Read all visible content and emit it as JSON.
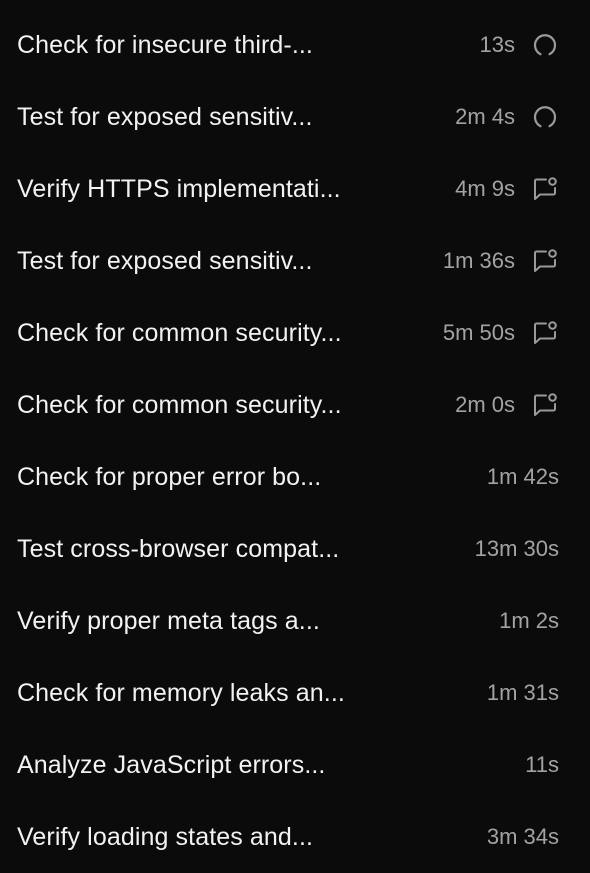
{
  "tasks": [
    {
      "title": "Check for insecure third-...",
      "duration": "13s",
      "icon": "spinner-icon"
    },
    {
      "title": "Test for exposed sensitiv...",
      "duration": "2m 4s",
      "icon": "spinner-icon"
    },
    {
      "title": "Verify HTTPS implementati...",
      "duration": "4m 9s",
      "icon": "comment-notification-icon"
    },
    {
      "title": "Test for exposed sensitiv...",
      "duration": "1m 36s",
      "icon": "comment-notification-icon"
    },
    {
      "title": "Check for common security...",
      "duration": "5m 50s",
      "icon": "comment-notification-icon"
    },
    {
      "title": "Check for common security...",
      "duration": "2m 0s",
      "icon": "comment-notification-icon"
    },
    {
      "title": "Check for proper error bo...",
      "duration": "1m 42s",
      "icon": ""
    },
    {
      "title": "Test cross-browser compat...",
      "duration": "13m 30s",
      "icon": ""
    },
    {
      "title": "Verify proper meta tags a...",
      "duration": "1m 2s",
      "icon": ""
    },
    {
      "title": "Check for memory leaks an...",
      "duration": "1m 31s",
      "icon": ""
    },
    {
      "title": "Analyze JavaScript errors...",
      "duration": "11s",
      "icon": ""
    },
    {
      "title": "Verify loading states and...",
      "duration": "3m 34s",
      "icon": ""
    }
  ],
  "colors": {
    "background": "#0c0b0b",
    "title_text": "#f2f2f2",
    "duration_text": "#a3a3a3",
    "icon_stroke": "#9a9a9a"
  }
}
